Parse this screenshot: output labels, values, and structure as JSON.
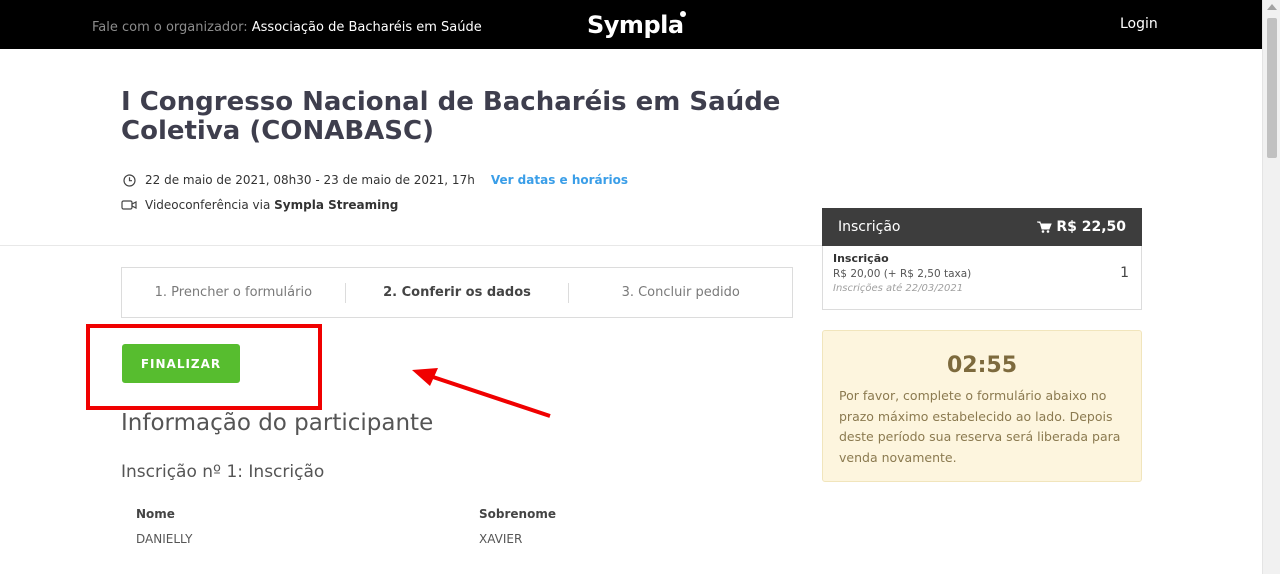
{
  "topbar": {
    "organizer_prefix": "Fale com o organizador: ",
    "organizer_name": "Associação de Bacharéis em Saúde",
    "logo": "Sympla",
    "login": "Login"
  },
  "event": {
    "title": "I Congresso Nacional de Bacharéis em Saúde Coletiva (CONABASC)",
    "date_text": "22 de maio de 2021, 08h30 - 23 de maio de 2021, 17h",
    "see_dates_link": "Ver datas e horários",
    "place_prefix": "Videoconferência via ",
    "place_bold": "Sympla Streaming"
  },
  "steps": [
    {
      "label": "1. Prencher o formulário",
      "active": false
    },
    {
      "label": "2. Conferir os dados",
      "active": true
    },
    {
      "label": "3. Concluir pedido",
      "active": false
    }
  ],
  "finalize_button": "FINALIZAR",
  "participant": {
    "section_title": "Informação do participante",
    "registration_title": "Inscrição nº 1: Inscrição",
    "fields": [
      {
        "label": "Nome",
        "value": "DANIELLY"
      },
      {
        "label": "Sobrenome",
        "value": "XAVIER"
      }
    ]
  },
  "summary": {
    "header_label": "Inscrição",
    "header_total": "R$ 22,50",
    "item_name": "Inscrição",
    "item_price": "R$ 20,00  (+ R$ 2,50 taxa)",
    "item_until": "Inscrições até 22/03/2021",
    "item_qty": "1"
  },
  "timer": {
    "value": "02:55",
    "message": "Por favor, complete o formulário abaixo no prazo máximo estabelecido ao lado. Depois deste período sua reserva será liberada para venda novamente."
  },
  "colors": {
    "topbar": "#000000",
    "finalize": "#57bd2f",
    "link": "#3a9ee8",
    "highlight_box": "#f00000",
    "timer_bg": "#fdf5de"
  },
  "icons": [
    "clock-icon",
    "video-camera-icon",
    "cart-icon"
  ]
}
